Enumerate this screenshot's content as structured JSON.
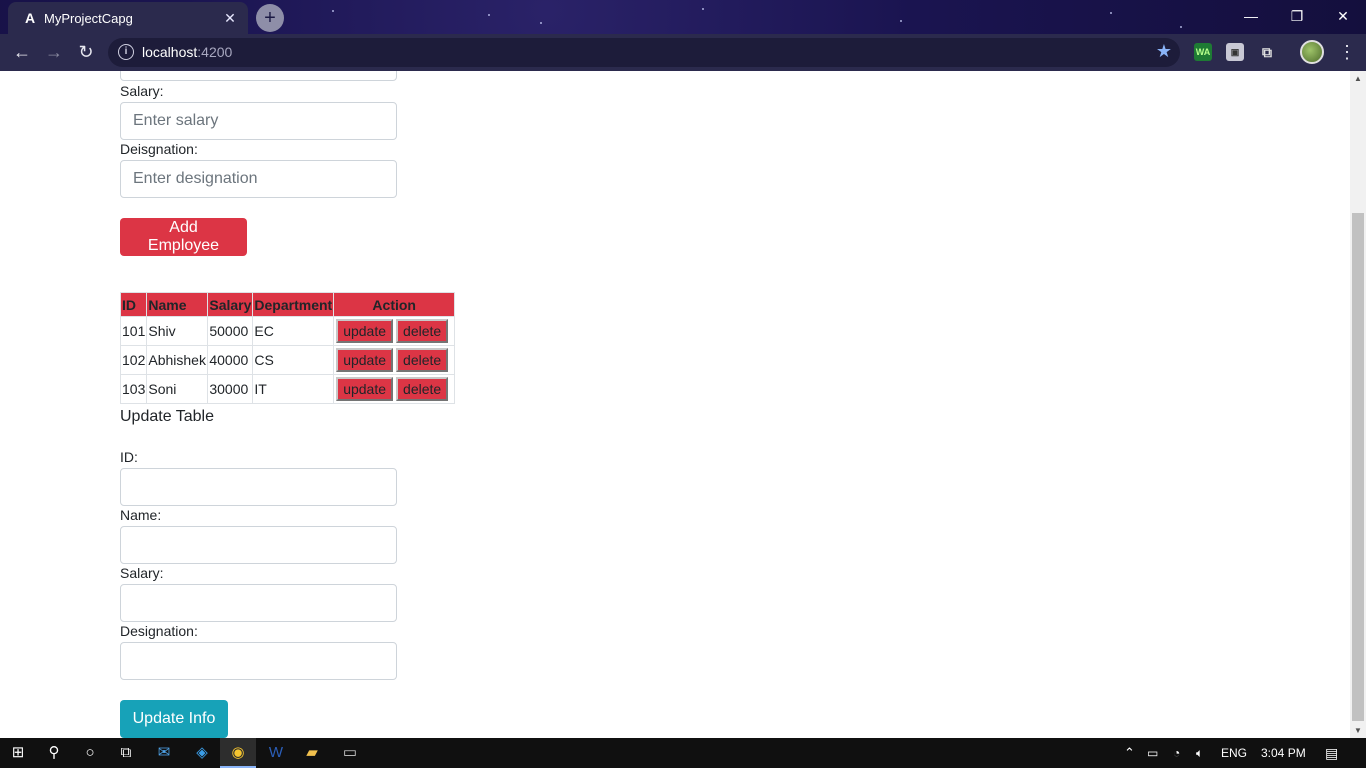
{
  "browser": {
    "tab_title": "MyProjectCapg",
    "tab_favicon": "A",
    "url_host": "localhost",
    "url_port": ":4200",
    "window_controls": [
      "minimize-icon",
      "restore-icon",
      "close-icon"
    ]
  },
  "form": {
    "salary_label": "Salary:",
    "salary_placeholder": "Enter salary",
    "designation_label": "Deisgnation:",
    "designation_placeholder": "Enter designation",
    "add_button": "Add Employee"
  },
  "table": {
    "headers": [
      "ID",
      "Name",
      "Salary",
      "Department",
      "Action"
    ],
    "rows": [
      {
        "id": "101",
        "name": "Shiv",
        "salary": "50000",
        "department": "EC"
      },
      {
        "id": "102",
        "name": "Abhishek",
        "salary": "40000",
        "department": "CS"
      },
      {
        "id": "103",
        "name": "Soni",
        "salary": "30000",
        "department": "IT"
      }
    ],
    "update_label": "update",
    "delete_label": "delete"
  },
  "update_form": {
    "heading": "Update Table",
    "id_label": "ID:",
    "name_label": "Name:",
    "salary_label": "Salary:",
    "designation_label": "Designation:",
    "button": "Update Info"
  },
  "taskbar": {
    "language": "ENG",
    "time": "3:04 PM"
  },
  "colors": {
    "danger": "#dc3545",
    "info": "#17a2b8",
    "titlebar": "#1a1450"
  }
}
